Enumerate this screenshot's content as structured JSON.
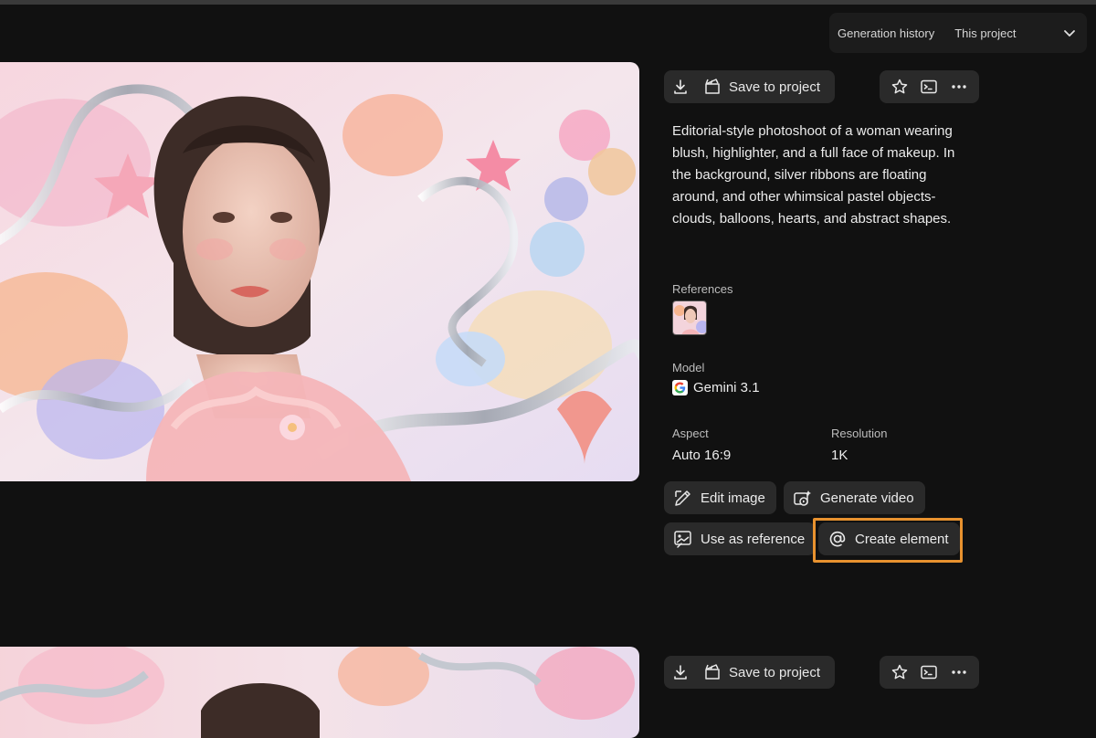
{
  "header": {
    "history_label": "Generation history",
    "history_value": "This project"
  },
  "generation": {
    "toolbar": {
      "save_label": "Save to project"
    },
    "prompt": "Editorial-style photoshoot of a woman wearing blush, highlighter, and a full face of makeup. In the background, silver ribbons are floating around, and other whimsical pastel objects- clouds, balloons, hearts, and abstract shapes.",
    "references_label": "References",
    "model_label": "Model",
    "model_value": "Gemini 3.1",
    "aspect_label": "Aspect",
    "aspect_value": "Auto 16:9",
    "resolution_label": "Resolution",
    "resolution_value": "1K",
    "actions": {
      "edit_image": "Edit image",
      "generate_video": "Generate video",
      "use_as_reference": "Use as reference",
      "create_element": "Create element"
    }
  },
  "generation2": {
    "toolbar": {
      "save_label": "Save to project"
    }
  },
  "colors": {
    "background": "#111111",
    "button_bg": "#2a2a2a",
    "highlight": "#e8922f"
  },
  "icons": [
    "download-icon",
    "save-to-project-icon",
    "star-icon",
    "prompt-terminal-icon",
    "more-icon",
    "chevron-down-icon",
    "edit-image-icon",
    "generate-video-icon",
    "use-as-reference-icon",
    "create-element-icon",
    "google-logo-icon"
  ]
}
